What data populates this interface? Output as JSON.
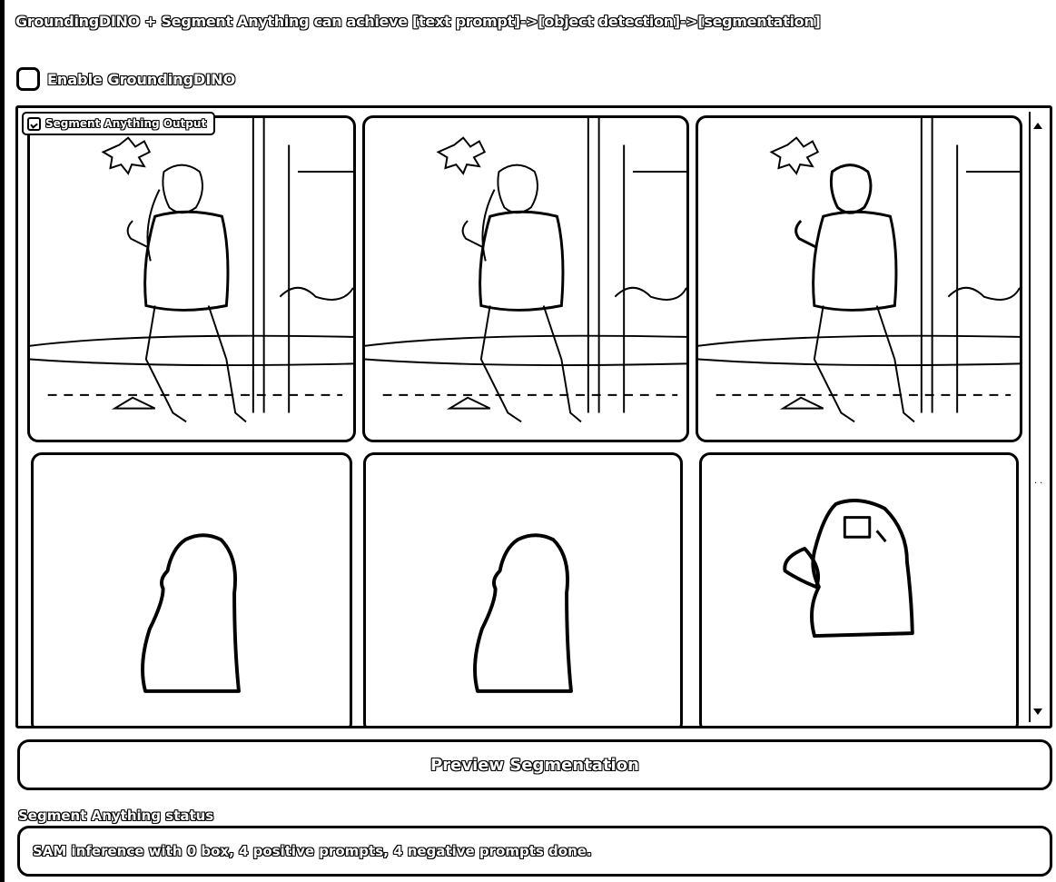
{
  "header": {
    "title": "GroundingDINO + Segment Anything can achieve [text prompt]->[object detection]->[segmentation]"
  },
  "grounding": {
    "enable_label": "Enable GroundingDINO",
    "checked": false
  },
  "gallery": {
    "label": "Segment Anything Output",
    "label_icon": "image-icon",
    "rows": [
      [
        "photo-sketch",
        "photo-sketch",
        "photo-sketch"
      ],
      [
        "mask-outline",
        "mask-outline",
        "mask-outline"
      ]
    ]
  },
  "actions": {
    "preview_label": "Preview Segmentation"
  },
  "status": {
    "label": "Segment Anything status",
    "text": "SAM inference with 0 box, 4 positive prompts, 4 negative prompts done."
  }
}
